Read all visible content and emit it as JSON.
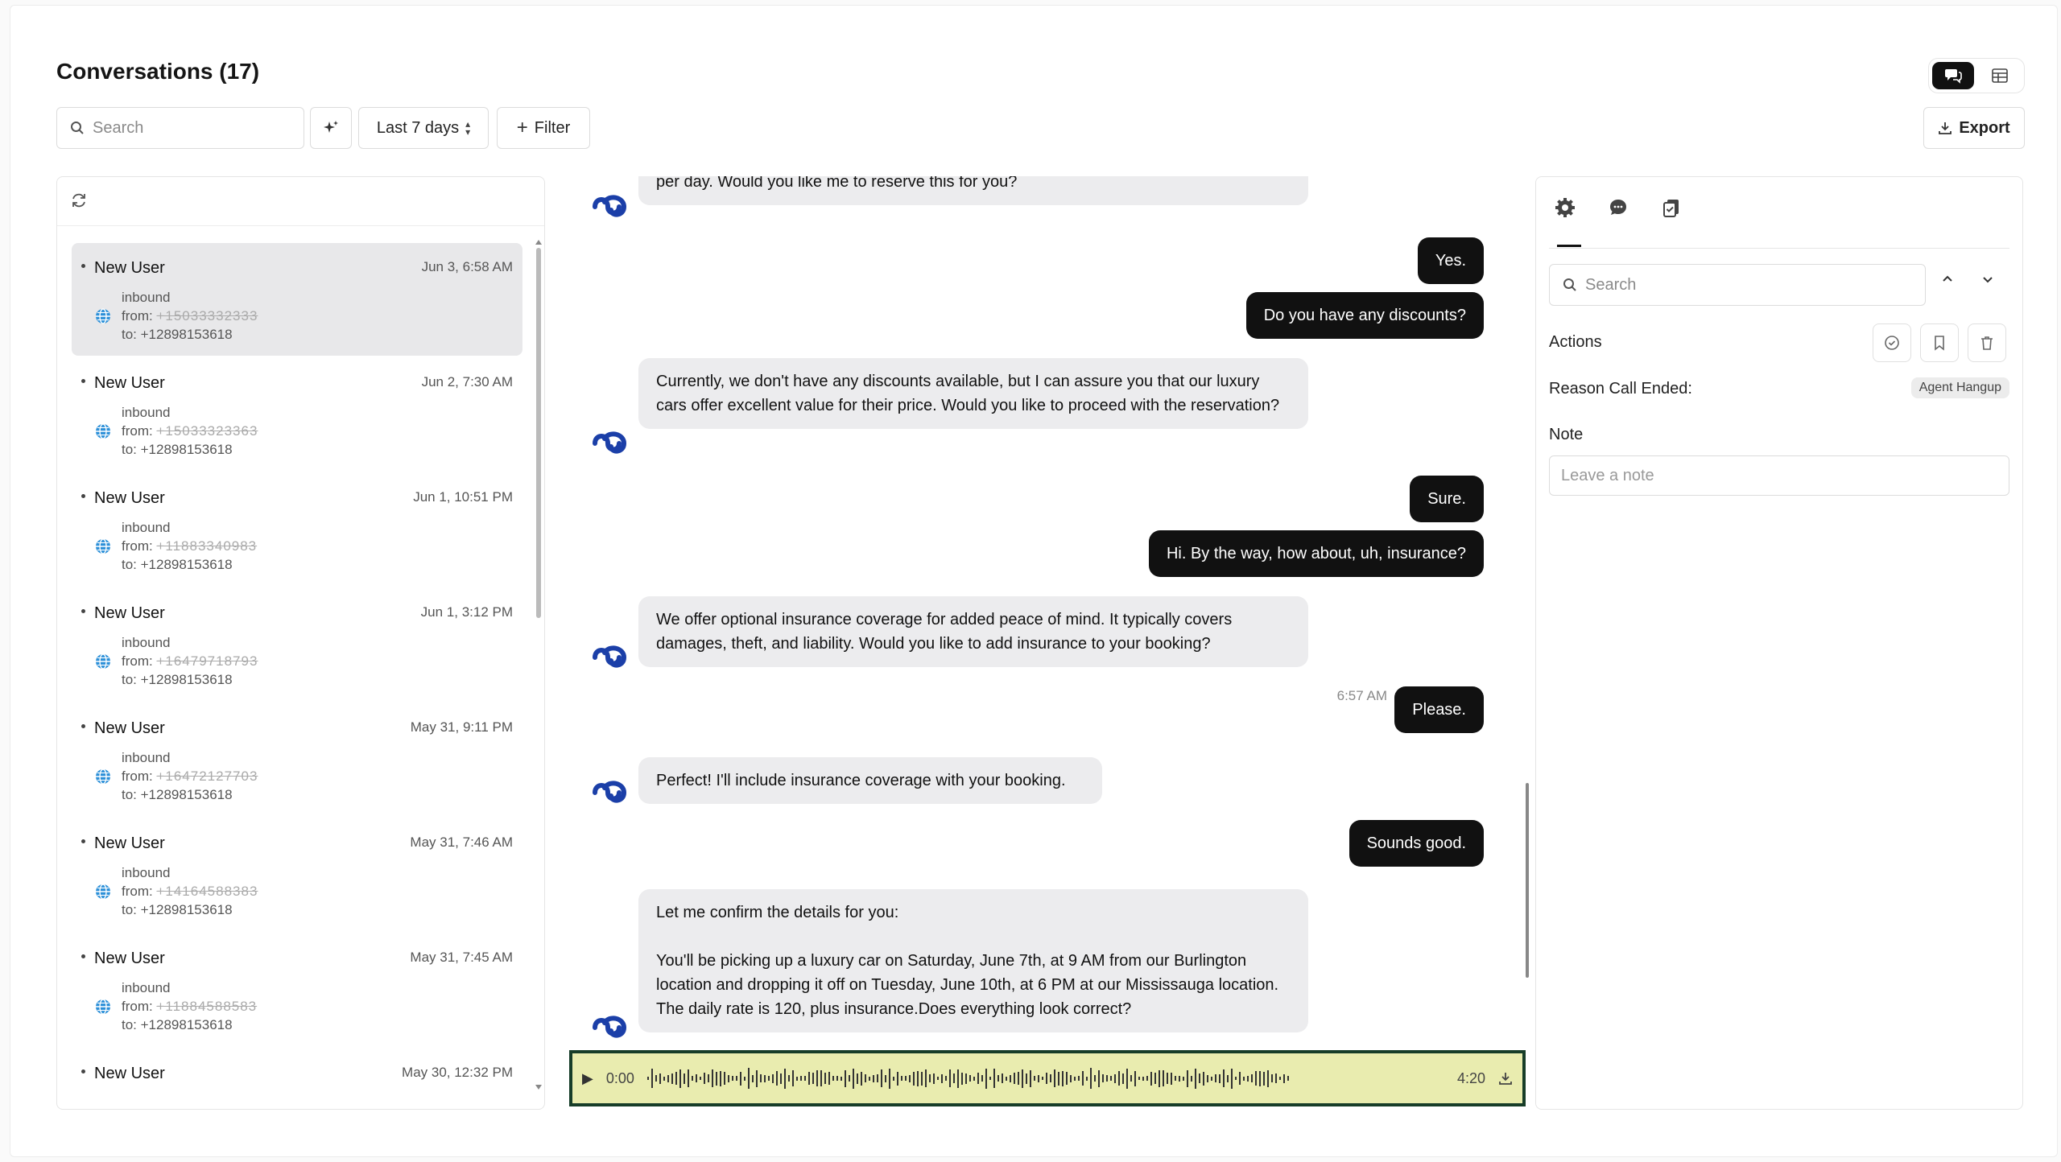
{
  "header": {
    "title": "Conversations (17)"
  },
  "toolbar": {
    "search_placeholder": "Search",
    "range_label": "Last 7 days",
    "filter_label": "Filter",
    "export_label": "Export"
  },
  "conversations": [
    {
      "name": "New User",
      "date": "Jun 3, 6:58 AM",
      "direction": "inbound",
      "from_label": "from:",
      "from_value": "+15033332333",
      "to": "to: +12898153618"
    },
    {
      "name": "New User",
      "date": "Jun 2, 7:30 AM",
      "direction": "inbound",
      "from_label": "from:",
      "from_value": "+15033323363",
      "to": "to: +12898153618"
    },
    {
      "name": "New User",
      "date": "Jun 1, 10:51 PM",
      "direction": "inbound",
      "from_label": "from:",
      "from_value": "+11883340983",
      "to": "to: +12898153618"
    },
    {
      "name": "New User",
      "date": "Jun 1, 3:12 PM",
      "direction": "inbound",
      "from_label": "from:",
      "from_value": "+16479718793",
      "to": "to: +12898153618"
    },
    {
      "name": "New User",
      "date": "May 31, 9:11 PM",
      "direction": "inbound",
      "from_label": "from:",
      "from_value": "+16472127703",
      "to": "to: +12898153618"
    },
    {
      "name": "New User",
      "date": "May 31, 7:46 AM",
      "direction": "inbound",
      "from_label": "from:",
      "from_value": "+14164588383",
      "to": "to: +12898153618"
    },
    {
      "name": "New User",
      "date": "May 31, 7:45 AM",
      "direction": "inbound",
      "from_label": "from:",
      "from_value": "+11884588583",
      "to": "to: +12898153618"
    },
    {
      "name": "New User",
      "date": "May 30, 12:32 PM",
      "direction": "",
      "from_label": "",
      "from_value": "",
      "to": ""
    }
  ],
  "messages": {
    "m1": "per day. Would you like me to reserve this for you?",
    "m2": "Yes.",
    "m3": "Do you have any discounts?",
    "m4": "Currently, we don't have any discounts available, but I can assure you that our luxury cars offer excellent value for their price. Would you like to proceed with the reservation?",
    "m5": "Sure.",
    "m6": "Hi. By the way, how about, uh, insurance?",
    "m7": "We offer optional insurance coverage for added peace of mind. It typically covers damages, theft, and liability. Would you like to add insurance to your booking?",
    "ts1": "6:57 AM",
    "m8": "Please.",
    "m9": "Perfect! I'll include insurance coverage with your booking.",
    "m10": "Sounds good.",
    "m11a": "Let me confirm the details for you:",
    "m11b": "You'll be picking up a luxury car on Saturday, June 7th, at 9 AM from our Burlington location and dropping it off on Tuesday, June 10th, at 6 PM at our Mississauga location. The daily rate is 120, plus insurance.Does everything look correct?"
  },
  "audio": {
    "current": "0:00",
    "duration": "4:20",
    "progress": 0
  },
  "details": {
    "search_placeholder": "Search",
    "actions_label": "Actions",
    "reason_label": "Reason Call Ended:",
    "reason_value": "Agent Hangup",
    "note_label": "Note",
    "note_placeholder": "Leave a note"
  },
  "colors": {
    "user_bubble": "#111111",
    "bot_bubble": "#ececee",
    "audio_bg": "#e9ecaf",
    "audio_border": "#173d28",
    "avatar_blue": "#1b3fa8"
  }
}
